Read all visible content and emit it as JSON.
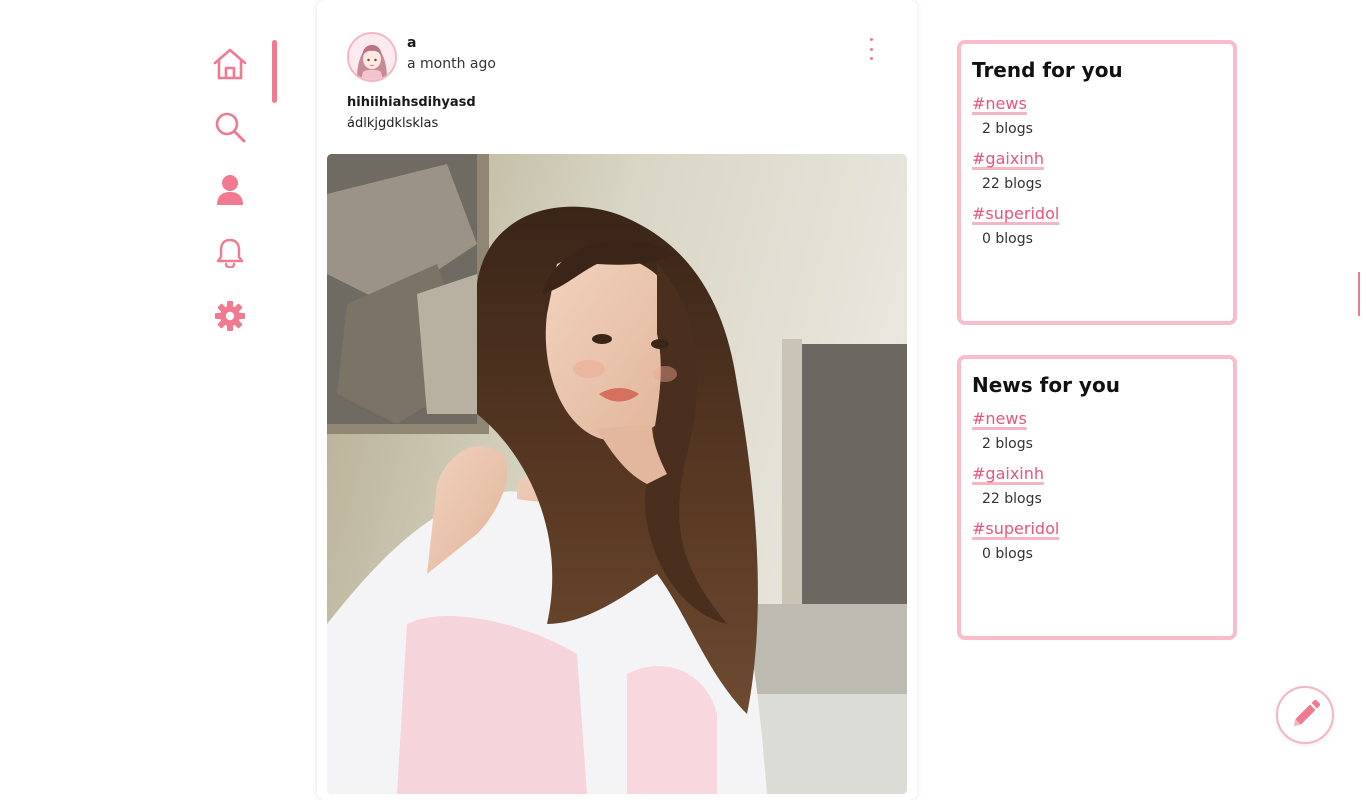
{
  "nav": {
    "items": [
      {
        "icon": "home-icon"
      },
      {
        "icon": "search-icon"
      },
      {
        "icon": "user-icon"
      },
      {
        "icon": "bell-icon"
      },
      {
        "icon": "gear-icon"
      }
    ],
    "active_index": 0
  },
  "post": {
    "author": "a",
    "time": "a month ago",
    "title": "hihiihiahsdihyasd",
    "body": "ádlkjgdklsklas"
  },
  "trend_panel": {
    "title": "Trend for you",
    "tags": [
      {
        "name": "#news",
        "count": "2 blogs"
      },
      {
        "name": "#gaixinh",
        "count": "22 blogs"
      },
      {
        "name": "#superidol",
        "count": "0 blogs"
      }
    ]
  },
  "news_panel": {
    "title": "News for you",
    "tags": [
      {
        "name": "#news",
        "count": "2 blogs"
      },
      {
        "name": "#gaixinh",
        "count": "22 blogs"
      },
      {
        "name": "#superidol",
        "count": "0 blogs"
      }
    ]
  },
  "colors": {
    "accent": "#f07a8f",
    "panel_border": "#f9bccb",
    "tag_text": "#e8557a"
  },
  "fab": {
    "icon": "pencil-icon"
  }
}
